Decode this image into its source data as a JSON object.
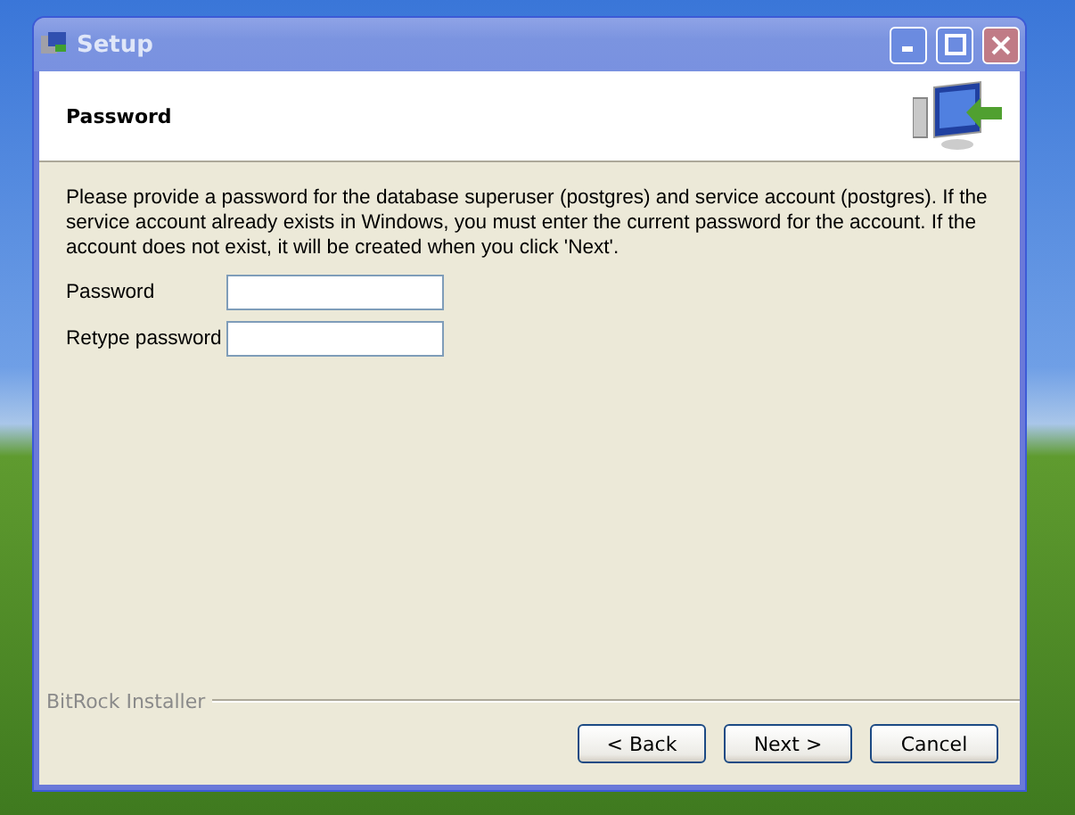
{
  "window": {
    "title": "Setup"
  },
  "header": {
    "title": "Password"
  },
  "description": "Please provide a password for the database superuser (postgres) and service account (postgres). If the service account already exists in Windows, you must enter the current password for the account. If the account does not exist, it will be created when you click 'Next'.",
  "fields": [
    {
      "label": "Password"
    },
    {
      "label": "Retype password"
    }
  ],
  "footer": {
    "brand": "BitRock Installer"
  },
  "buttons": [
    {
      "label": "< Back"
    },
    {
      "label": "Next >"
    },
    {
      "label": "Cancel"
    }
  ]
}
